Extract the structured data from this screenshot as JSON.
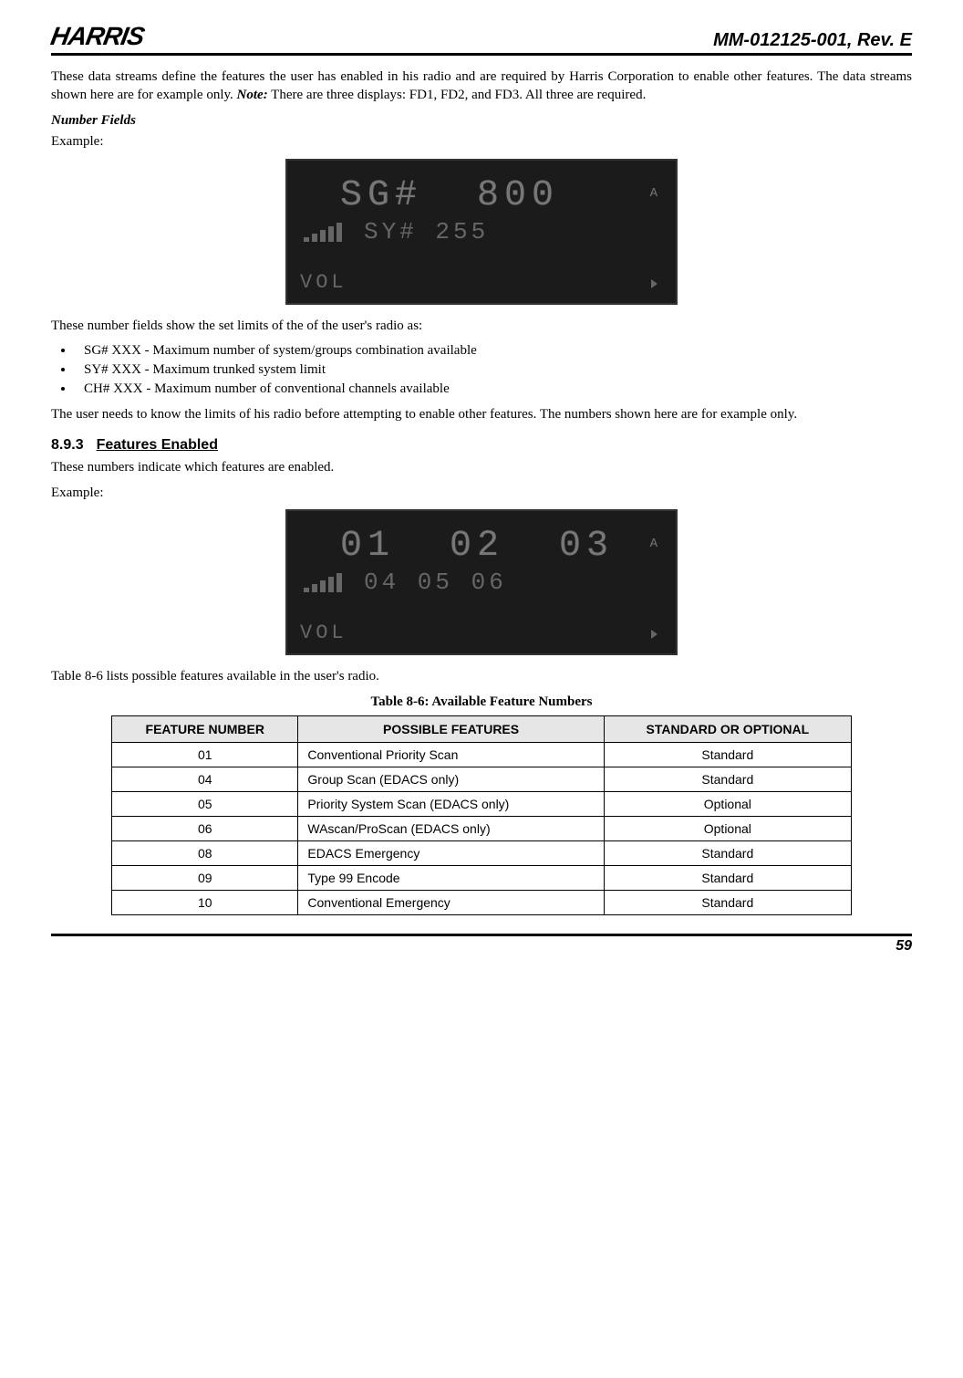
{
  "header": {
    "logo_text": "HARRIS",
    "doc_id": "MM-012125-001, Rev. E"
  },
  "intro_para": "These data streams define the features the user has enabled in his radio and are required by Harris Corporation to enable other features. The data streams shown here are for example only. ",
  "intro_note_label": "Note:",
  "intro_note_rest": " There are three displays: FD1, FD2, and FD3. All three are required.",
  "number_fields_heading": "Number Fields",
  "example_label": "Example:",
  "lcd1": {
    "line1": "SG#  800",
    "line2": "SY# 255",
    "vol": "VOL",
    "side_a": "A"
  },
  "nf_intro": "These number fields show the set limits of the of the user's radio as:",
  "nf_bullets": [
    "SG# XXX - Maximum number of system/groups combination available",
    "SY# XXX - Maximum trunked system limit",
    "CH# XXX - Maximum number of conventional channels available"
  ],
  "nf_outro": "The user needs to know the limits of his radio before attempting to enable other features. The numbers shown here are for example only.",
  "section": {
    "num": "8.9.3",
    "title": "Features Enabled"
  },
  "fe_intro": "These numbers indicate which features are enabled.",
  "lcd2": {
    "line1": "01  02  03",
    "line2": "04 05 06",
    "vol": "VOL",
    "side_a": "A"
  },
  "table_ref": "Table 8-6 lists possible features available in the user's radio.",
  "table_caption": "Table 8-6: Available Feature Numbers",
  "table_headers": {
    "col1": "FEATURE NUMBER",
    "col2": "POSSIBLE FEATURES",
    "col3": "STANDARD OR OPTIONAL"
  },
  "table_rows": [
    {
      "num": "01",
      "feat": "Conventional Priority Scan",
      "type": "Standard"
    },
    {
      "num": "04",
      "feat": "Group Scan (EDACS only)",
      "type": "Standard"
    },
    {
      "num": "05",
      "feat": "Priority System Scan (EDACS only)",
      "type": "Optional"
    },
    {
      "num": "06",
      "feat": "WAscan/ProScan (EDACS only)",
      "type": "Optional"
    },
    {
      "num": "08",
      "feat": "EDACS Emergency",
      "type": "Standard"
    },
    {
      "num": "09",
      "feat": "Type 99 Encode",
      "type": "Standard"
    },
    {
      "num": "10",
      "feat": "Conventional Emergency",
      "type": "Standard"
    }
  ],
  "page_number": "59"
}
